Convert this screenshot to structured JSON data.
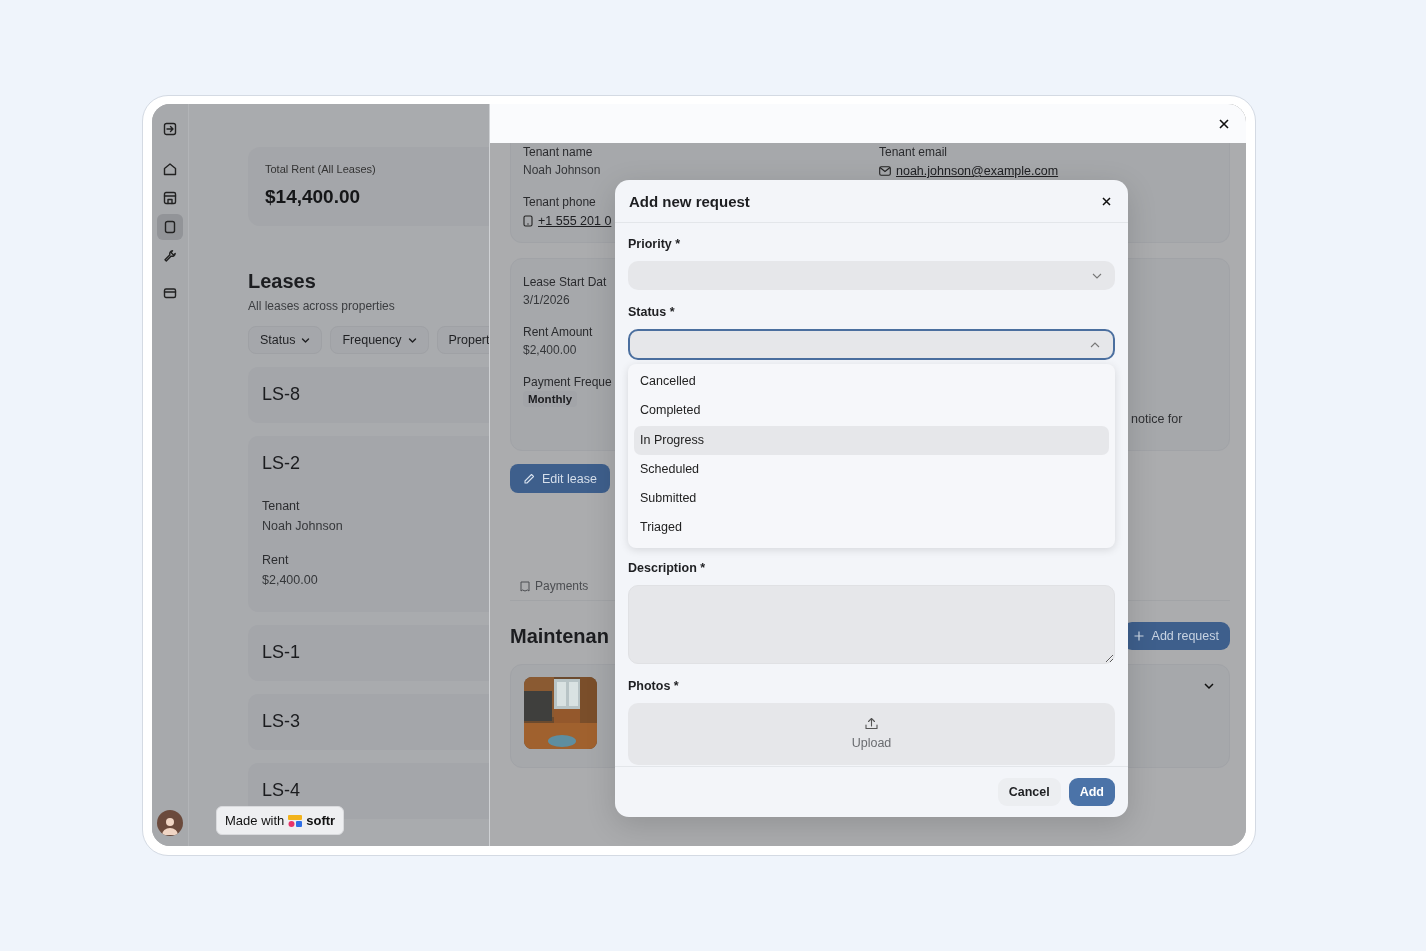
{
  "sidebar": {
    "items": [
      {
        "selected": false
      },
      {
        "selected": false
      },
      {
        "selected": false
      },
      {
        "selected": true
      },
      {
        "selected": false
      },
      {
        "selected": false
      }
    ]
  },
  "summary": {
    "label": "Total Rent (All Leases)",
    "value": "$14,400.00"
  },
  "leases": {
    "title": "Leases",
    "subtitle": "All leases across properties",
    "filters": [
      {
        "label": "Status",
        "caret": true
      },
      {
        "label": "Frequency",
        "caret": true
      },
      {
        "label": "Propert",
        "caret": false
      }
    ],
    "items": [
      {
        "code": "LS-8"
      },
      {
        "code": "LS-2",
        "fields": [
          {
            "label": "Tenant",
            "value": "Noah Johnson"
          },
          {
            "label": "Rent",
            "value": "$2,400.00"
          }
        ]
      },
      {
        "code": "LS-1"
      },
      {
        "code": "LS-3"
      },
      {
        "code": "LS-4"
      }
    ]
  },
  "badge": {
    "prefix": "Made with",
    "brand": "softr"
  },
  "drawer": {
    "tenant_card": {
      "columns": [
        [
          {
            "label": "Tenant name",
            "value": "Noah Johnson",
            "kind": "text"
          },
          {
            "label": "Tenant phone",
            "value": "+1 555 201 0",
            "kind": "phone"
          }
        ],
        [
          {
            "label": "Tenant email",
            "value": "noah.johnson@example.com",
            "kind": "email"
          }
        ]
      ]
    },
    "lease_card": {
      "fields": [
        {
          "label": "Lease Start Dat",
          "value": "3/1/2026",
          "kind": "text"
        },
        {
          "label": "Rent Amount",
          "value": "$2,400.00",
          "kind": "text"
        },
        {
          "label": "Payment Freque",
          "value": "Monthly",
          "kind": "tag"
        }
      ],
      "note": "notice for"
    },
    "edit_button": "Edit lease",
    "tabs": [
      {
        "label": "Payments",
        "selected": false
      }
    ],
    "maintenance": {
      "title": "Maintenan",
      "add_button": "Add request"
    }
  },
  "modal": {
    "title": "Add new request",
    "fields": [
      {
        "kind": "select",
        "label": "Priority *",
        "open": false
      },
      {
        "kind": "select",
        "label": "Status *",
        "open": true,
        "options": [
          {
            "label": "Cancelled",
            "highlighted": false
          },
          {
            "label": "Completed",
            "highlighted": false
          },
          {
            "label": "In Progress",
            "highlighted": true
          },
          {
            "label": "Scheduled",
            "highlighted": false
          },
          {
            "label": "Submitted",
            "highlighted": false
          },
          {
            "label": "Triaged",
            "highlighted": false
          }
        ]
      },
      {
        "kind": "textarea",
        "label": "Description *"
      },
      {
        "kind": "upload",
        "label": "Photos *",
        "button": "Upload"
      }
    ],
    "buttons": [
      {
        "label": "Cancel",
        "kind": "secondary"
      },
      {
        "label": "Add",
        "kind": "primary"
      }
    ]
  }
}
